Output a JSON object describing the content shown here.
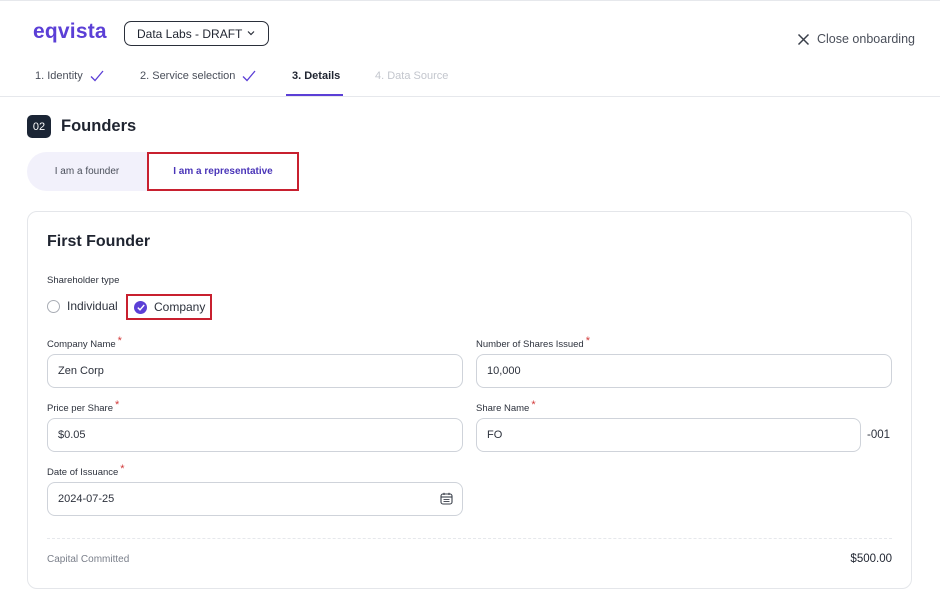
{
  "header": {
    "logo": "eqvista",
    "workspace": "Data Labs - DRAFT",
    "close_label": "Close onboarding"
  },
  "steps": [
    {
      "label": "1. Identity",
      "status": "done"
    },
    {
      "label": "2. Service selection",
      "status": "done"
    },
    {
      "label": "3. Details",
      "status": "active"
    },
    {
      "label": "4. Data Source",
      "status": "disabled"
    }
  ],
  "section": {
    "number": "02",
    "title": "Founders",
    "roles": [
      "I am a founder",
      "I am a representative"
    ],
    "selected_role": "I am a representative"
  },
  "founder_card": {
    "title": "First Founder",
    "shareholder_type_label": "Shareholder type",
    "shareholder_types": [
      "Individual",
      "Company"
    ],
    "selected_type": "Company",
    "fields": {
      "company_name": {
        "label": "Company Name",
        "value": "Zen Corp"
      },
      "shares_issued": {
        "label": "Number of Shares Issued",
        "value": "10,000"
      },
      "price_per_share": {
        "label": "Price per Share",
        "value": "$0.05"
      },
      "share_name": {
        "label": "Share Name",
        "value": "FO",
        "suffix": "-001"
      },
      "date_of_issuance": {
        "label": "Date of Issuance",
        "value": "2024-07-25"
      }
    },
    "required_mark": "*",
    "capital_label": "Capital Committed",
    "capital_value": "$500.00"
  },
  "colors": {
    "brand": "#5b3fd6",
    "highlight_border": "#c8202f",
    "badge_bg": "#1b2535"
  }
}
